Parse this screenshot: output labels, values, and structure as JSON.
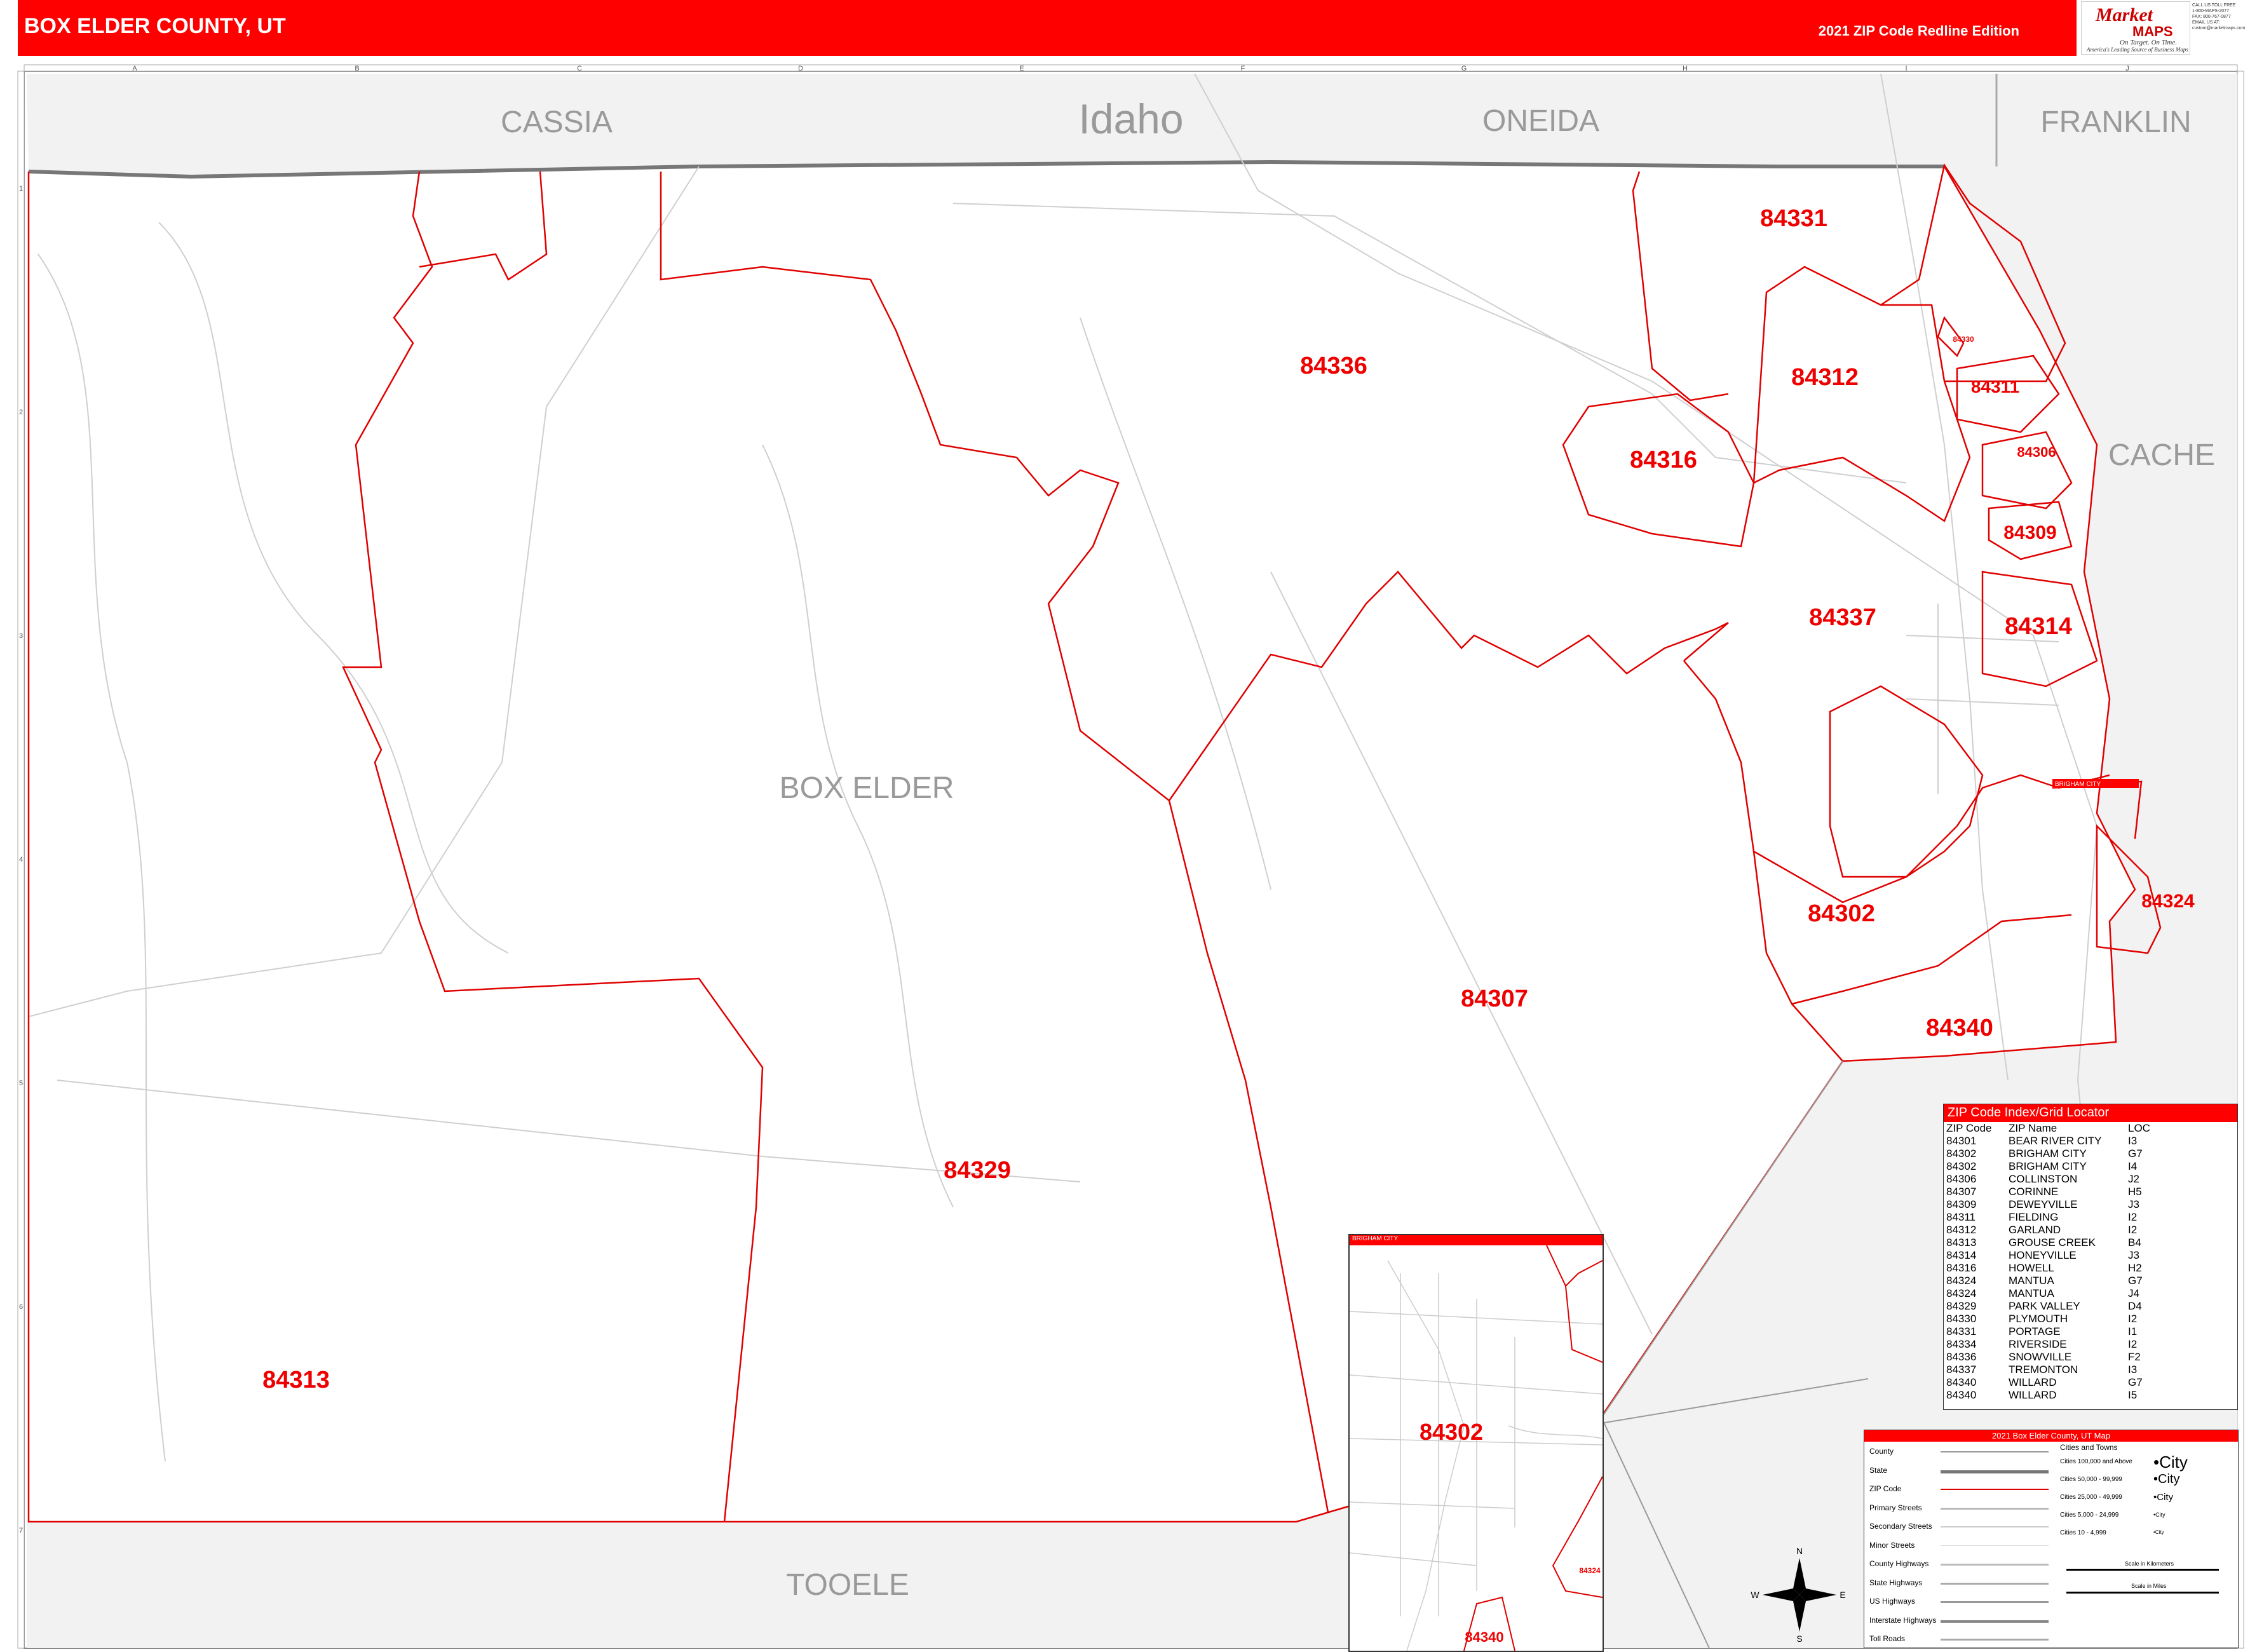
{
  "header": {
    "title": "BOX ELDER COUNTY, UT",
    "edition": "2021 ZIP Code Redline Edition"
  },
  "logo": {
    "brand_top": "Market",
    "brand_bottom": "MAPS",
    "tagline1": "On Target. On Time.",
    "tagline2": "America's Leading Source of Business Maps",
    "contact": [
      "CALL US TOLL FREE",
      "1-800-MAPS-2077",
      "FAX: 800-767-0877",
      "EMAIL US AT:",
      "custom@marketmaps.com"
    ]
  },
  "grid": {
    "columns": [
      "A",
      "B",
      "C",
      "D",
      "E",
      "F",
      "G",
      "H",
      "I",
      "J"
    ],
    "rows": [
      "1",
      "2",
      "3",
      "4",
      "5",
      "6",
      "7"
    ]
  },
  "regions": {
    "cassia": "CASSIA",
    "idaho": "Idaho",
    "oneida": "ONEIDA",
    "franklin": "FRANKLIN",
    "cache": "CACHE",
    "box_elder": "BOX ELDER",
    "tooele": "TOOELE"
  },
  "zip_labels": {
    "z84331": "84331",
    "z84336": "84336",
    "z84312": "84312",
    "z84316": "84316",
    "z84311": "84311",
    "z84306": "84306",
    "z84309": "84309",
    "z84337": "84337",
    "z84314": "84314",
    "z84302": "84302",
    "z84324": "84324",
    "z84307": "84307",
    "z84340": "84340",
    "z84329": "84329",
    "z84313": "84313",
    "z84330": "84330"
  },
  "index": {
    "title": "ZIP Code Index/Grid Locator",
    "headers": [
      "ZIP Code",
      "ZIP Name",
      "LOC"
    ],
    "rows": [
      [
        "84301",
        "BEAR RIVER CITY",
        "I3"
      ],
      [
        "84302",
        "BRIGHAM CITY",
        "G7"
      ],
      [
        "84302",
        "BRIGHAM CITY",
        "I4"
      ],
      [
        "84306",
        "COLLINSTON",
        "J2"
      ],
      [
        "84307",
        "CORINNE",
        "H5"
      ],
      [
        "84309",
        "DEWEYVILLE",
        "J3"
      ],
      [
        "84311",
        "FIELDING",
        "I2"
      ],
      [
        "84312",
        "GARLAND",
        "I2"
      ],
      [
        "84313",
        "GROUSE CREEK",
        "B4"
      ],
      [
        "84314",
        "HONEYVILLE",
        "J3"
      ],
      [
        "84316",
        "HOWELL",
        "H2"
      ],
      [
        "84324",
        "MANTUA",
        "G7"
      ],
      [
        "84324",
        "MANTUA",
        "J4"
      ],
      [
        "84329",
        "PARK VALLEY",
        "D4"
      ],
      [
        "84330",
        "PLYMOUTH",
        "I2"
      ],
      [
        "84331",
        "PORTAGE",
        "I1"
      ],
      [
        "84334",
        "RIVERSIDE",
        "I2"
      ],
      [
        "84336",
        "SNOWVILLE",
        "F2"
      ],
      [
        "84337",
        "TREMONTON",
        "I3"
      ],
      [
        "84340",
        "WILLARD",
        "G7"
      ],
      [
        "84340",
        "WILLARD",
        "I5"
      ]
    ]
  },
  "legend": {
    "title": "2021 Box Elder County, UT Map",
    "left_items": [
      "County",
      "State",
      "ZIP Code",
      "Primary Streets",
      "Secondary Streets",
      "Minor Streets",
      "County Highways",
      "State Highways",
      "US Highways",
      "Interstate Highways",
      "Toll Roads"
    ],
    "cities_title": "Cities and Towns",
    "city_sizes": [
      "Cities 100,000 and Above",
      "Cities 50,000 - 99,999",
      "Cities 25,000 - 49,999",
      "Cities 5,000 - 24,999",
      "Cities 10 - 4,999"
    ],
    "city_samples": [
      "•City",
      "•City",
      "•City",
      "•City",
      "•City"
    ],
    "scale_km": "Scale in Kilometers",
    "scale_mi": "Scale in Miles"
  },
  "compass": {
    "n": "N",
    "s": "S",
    "e": "E",
    "w": "W"
  },
  "inset": {
    "title": "BRIGHAM CITY",
    "zip_main": "84302",
    "zip_bottom": "84340",
    "zip_right": "84324",
    "callout": "BRIGHAM CITY"
  },
  "colors": {
    "zip_line": "#e00000",
    "header": "#ff0000",
    "outside_fill": "#f2f2f2",
    "state_line": "#777777"
  }
}
